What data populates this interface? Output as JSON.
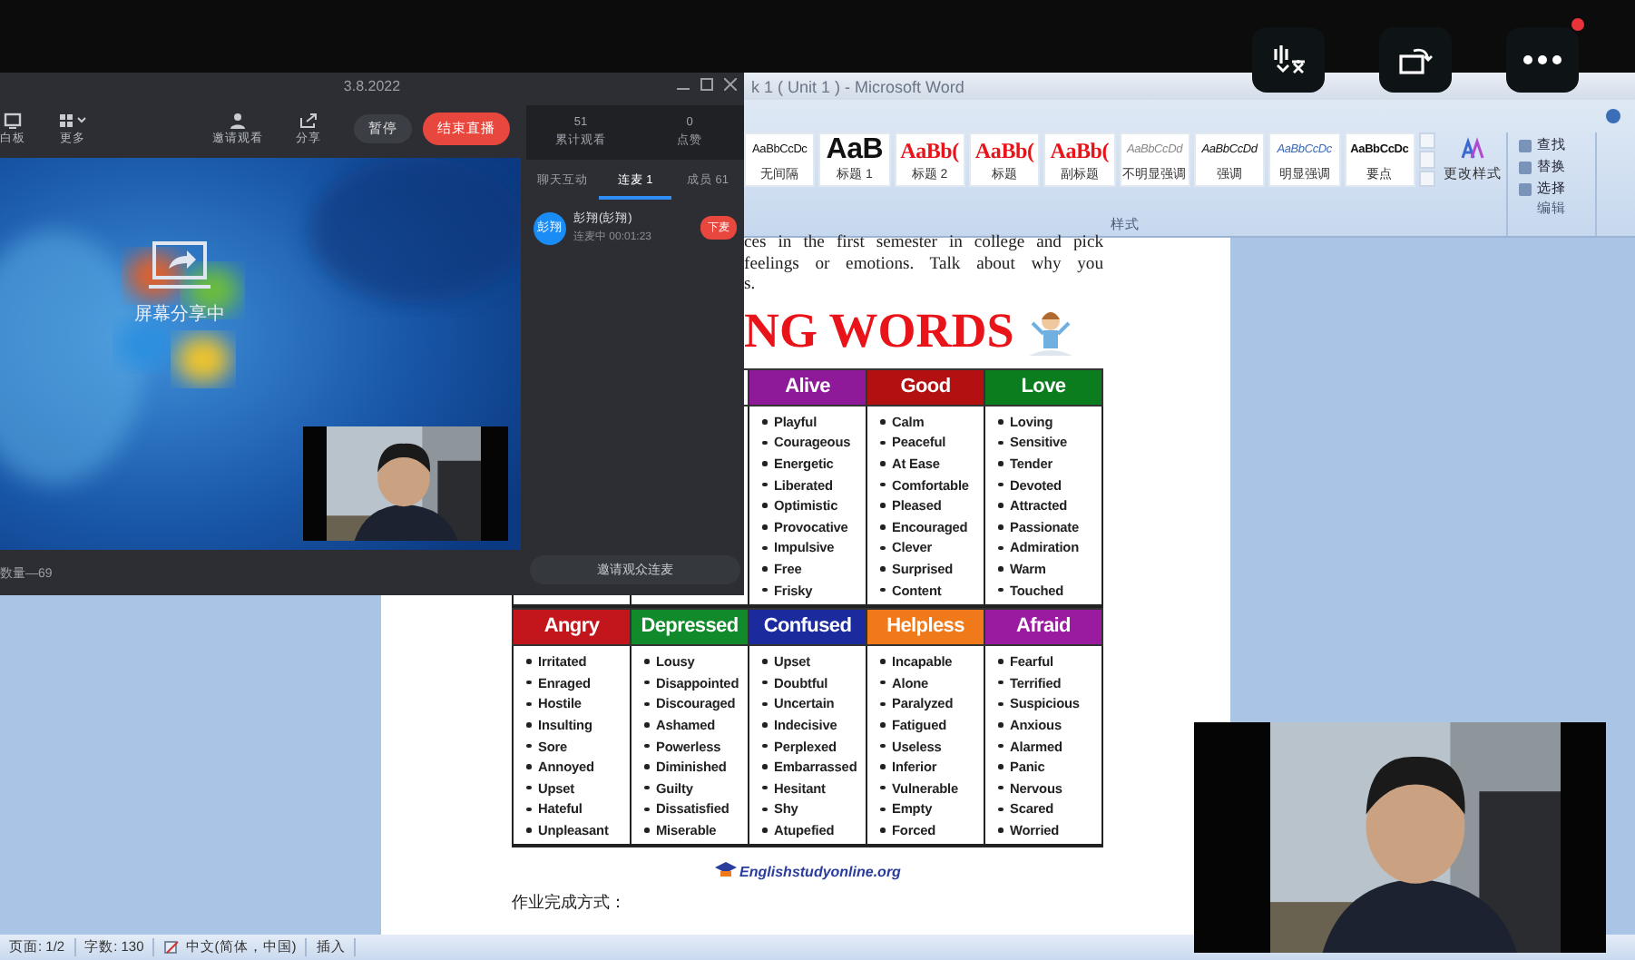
{
  "screen_controls": {
    "notification": true
  },
  "word": {
    "title": "k 1 ( Unit 1 )  - Microsoft Word",
    "styles": [
      {
        "sample": "AaBbCcDc",
        "label": "无间隔",
        "kind": "normal"
      },
      {
        "sample": "AaB",
        "label": "标题 1",
        "kind": "heading1"
      },
      {
        "sample": "AaBb(",
        "label": "标题 2",
        "kind": "heading"
      },
      {
        "sample": "AaBb(",
        "label": "标题",
        "kind": "heading"
      },
      {
        "sample": "AaBb(",
        "label": "副标题",
        "kind": "heading"
      },
      {
        "sample": "AaBbCcDd",
        "label": "不明显强调",
        "kind": "subtle"
      },
      {
        "sample": "AaBbCcDd",
        "label": "强调",
        "kind": "emphasis"
      },
      {
        "sample": "AaBbCcDc",
        "label": "明显强调",
        "kind": "intense"
      },
      {
        "sample": "AaBbCcDc",
        "label": "要点",
        "kind": "strong"
      }
    ],
    "change_styles": "更改样式",
    "styles_group": "样式",
    "editing": [
      "查找",
      "替换",
      "选择"
    ],
    "editing_group": "编辑"
  },
  "document": {
    "intro_lines": [
      "ces in the first semester in college and pick",
      "feelings or emotions. Talk about why you",
      "s."
    ],
    "heading": "NG WORDS",
    "tables": [
      {
        "kind": "covered",
        "columns": [
          {
            "name": "Alive",
            "color": "#8e1a9a",
            "items": [
              "Playful",
              "Courageous",
              "Energetic",
              "Liberated",
              "Optimistic",
              "Provocative",
              "Impulsive",
              "Free",
              "Frisky"
            ]
          },
          {
            "name": "Good",
            "color": "#b31111",
            "items": [
              "Calm",
              "Peaceful",
              "At Ease",
              "Comfortable",
              "Pleased",
              "Encouraged",
              "Clever",
              "Surprised",
              "Content"
            ]
          },
          {
            "name": "Love",
            "color": "#0c7d1f",
            "items": [
              "Loving",
              "Sensitive",
              "Tender",
              "Devoted",
              "Attracted",
              "Passionate",
              "Admiration",
              "Warm",
              "Touched"
            ]
          }
        ]
      },
      {
        "kind": "full",
        "columns": [
          {
            "name": "Angry",
            "color": "#c3161c",
            "items": [
              "Irritated",
              "Enraged",
              "Hostile",
              "Insulting",
              "Sore",
              "Annoyed",
              "Upset",
              "Hateful",
              "Unpleasant"
            ]
          },
          {
            "name": "Depressed",
            "color": "#108a2b",
            "items": [
              "Lousy",
              "Disappointed",
              "Discouraged",
              "Ashamed",
              "Powerless",
              "Diminished",
              "Guilty",
              "Dissatisfied",
              "Miserable"
            ]
          },
          {
            "name": "Confused",
            "color": "#1b2a9c",
            "items": [
              "Upset",
              "Doubtful",
              "Uncertain",
              "Indecisive",
              "Perplexed",
              "Embarrassed",
              "Hesitant",
              "Shy",
              "Atupefied"
            ]
          },
          {
            "name": "Helpless",
            "color": "#f07a1a",
            "items": [
              "Incapable",
              "Alone",
              "Paralyzed",
              "Fatigued",
              "Useless",
              "Inferior",
              "Vulnerable",
              "Empty",
              "Forced"
            ]
          },
          {
            "name": "Afraid",
            "color": "#9a1aa0",
            "items": [
              "Fearful",
              "Terrified",
              "Suspicious",
              "Anxious",
              "Alarmed",
              "Panic",
              "Nervous",
              "Scared",
              "Worried"
            ]
          }
        ]
      }
    ],
    "site": "Englishstudyonline.org",
    "footer_text": "作业完成方式："
  },
  "status_bar": [
    "页面: 1/2",
    "字数: 130",
    "中文(简体，中国)",
    "插入"
  ],
  "meeting": {
    "title": "3.8.2022",
    "tools": [
      {
        "label": "白板",
        "kind": "board"
      },
      {
        "label": "更多",
        "kind": "grid"
      },
      {
        "label": "邀请观看",
        "kind": "people"
      },
      {
        "label": "分享",
        "kind": "share"
      }
    ],
    "pause": "暂停",
    "end": "结束直播",
    "sharing_text": "屏幕分享中",
    "bottom_text": "数量—69",
    "stats": [
      {
        "value": "51",
        "label": "累计观看"
      },
      {
        "value": "0",
        "label": "点赞"
      }
    ],
    "tabs": [
      {
        "label": "聊天互动",
        "selected": false
      },
      {
        "label": "连麦 1",
        "selected": true
      },
      {
        "label": "成员 61",
        "selected": false
      }
    ],
    "member": {
      "avatar": "彭翔",
      "name": "彭翔(彭翔)",
      "status": "连麦中 00:01:23",
      "action": "下麦"
    },
    "invite": "邀请观众连麦"
  }
}
